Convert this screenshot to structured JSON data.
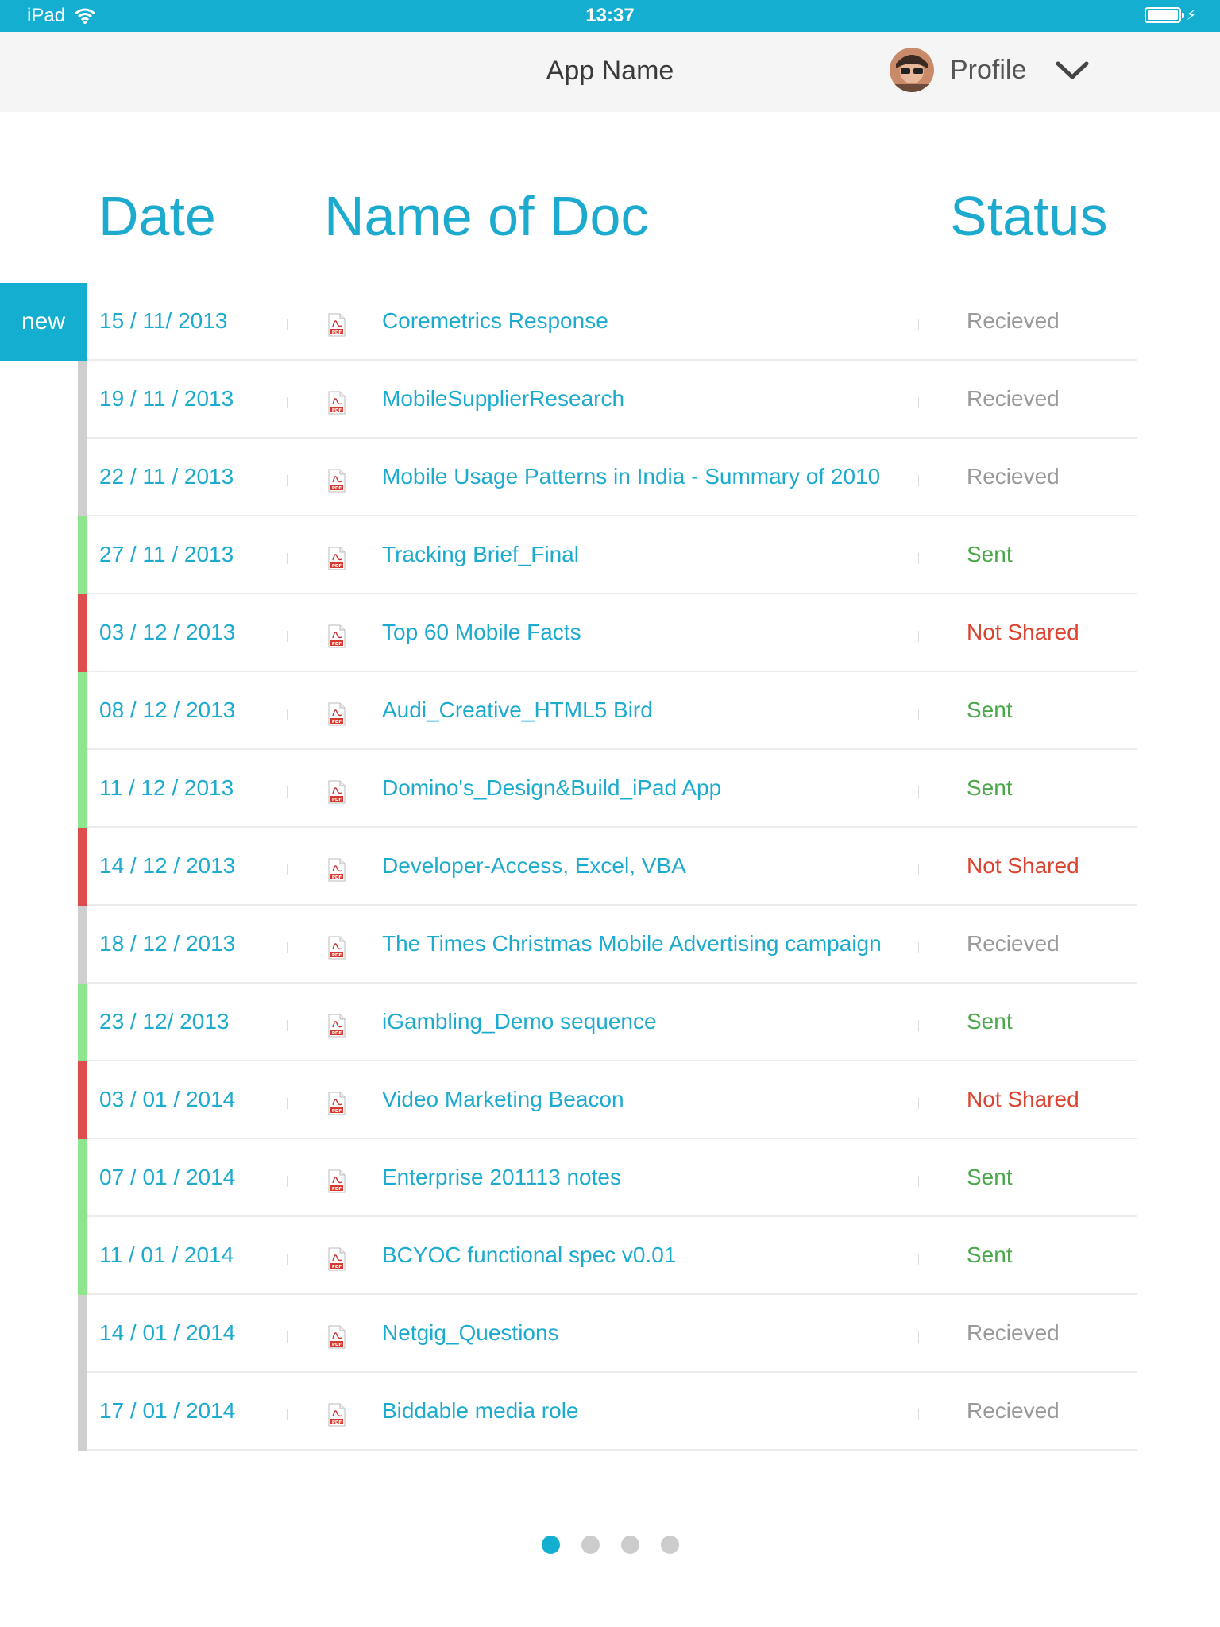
{
  "status_bar": {
    "device": "iPad",
    "time": "13:37"
  },
  "nav": {
    "title": "App Name",
    "profile_label": "Profile"
  },
  "table": {
    "headers": {
      "date": "Date",
      "name": "Name of Doc",
      "status": "Status"
    },
    "new_badge": "new",
    "status_colors": {
      "Recieved": "#9a9a9a",
      "Sent": "#4aa84a",
      "Not Shared": "#d9432f"
    },
    "bar_colors": {
      "Recieved": "#cfcfcf",
      "Sent": "#8fe58c",
      "Not Shared": "#de4d4d"
    },
    "rows": [
      {
        "date": "15 / 11/ 2013",
        "name": "Coremetrics Response",
        "status": "Recieved"
      },
      {
        "date": "19 / 11 / 2013",
        "name": "MobileSupplierResearch",
        "status": "Recieved"
      },
      {
        "date": "22 / 11 / 2013",
        "name": "Mobile Usage Patterns in India - Summary of 2010",
        "status": "Recieved"
      },
      {
        "date": "27 / 11 / 2013",
        "name": "Tracking Brief_Final",
        "status": "Sent"
      },
      {
        "date": "03 / 12 / 2013",
        "name": "Top 60 Mobile Facts",
        "status": "Not Shared"
      },
      {
        "date": "08 / 12 / 2013",
        "name": "Audi_Creative_HTML5 Bird",
        "status": "Sent"
      },
      {
        "date": "11 / 12 / 2013",
        "name": "Domino's_Design&Build_iPad App",
        "status": "Sent"
      },
      {
        "date": "14 / 12 / 2013",
        "name": "Developer-Access, Excel, VBA",
        "status": "Not Shared"
      },
      {
        "date": "18 / 12 / 2013",
        "name": "The Times Christmas Mobile Advertising campaign",
        "status": "Recieved"
      },
      {
        "date": "23 / 12/ 2013",
        "name": "iGambling_Demo sequence",
        "status": "Sent"
      },
      {
        "date": "03 / 01 / 2014",
        "name": "Video Marketing Beacon",
        "status": "Not Shared"
      },
      {
        "date": "07 / 01 / 2014",
        "name": "Enterprise 201113 notes",
        "status": "Sent"
      },
      {
        "date": "11 / 01 / 2014",
        "name": "BCYOC functional spec v0.01",
        "status": "Sent"
      },
      {
        "date": "14 / 01 / 2014",
        "name": "Netgig_Questions",
        "status": "Recieved"
      },
      {
        "date": "17 / 01 / 2014",
        "name": "Biddable media role",
        "status": "Recieved"
      }
    ],
    "file_icon": "pdf-icon",
    "file_icon_label": "PDF"
  },
  "pager": {
    "page_count": 4,
    "active_page": 1
  }
}
